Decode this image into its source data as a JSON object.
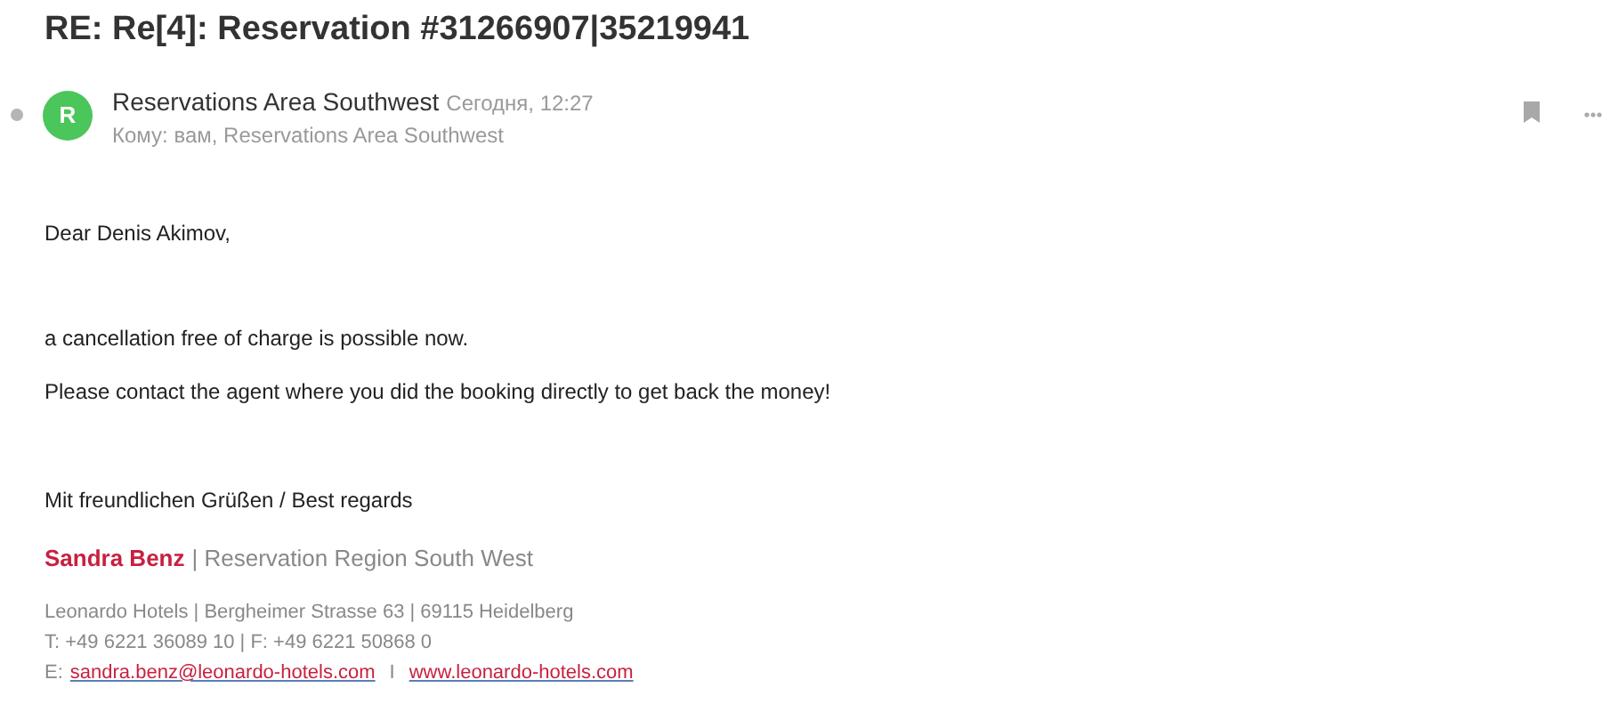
{
  "subject": "RE: Re[4]: Reservation #31266907|35219941",
  "sender": {
    "avatar_letter": "R",
    "name": "Reservations Area Southwest",
    "date": "Сегодня, 12:27",
    "to": "Кому: вам, Reservations Area Southwest"
  },
  "body": {
    "greeting": "Dear Denis Akimov,",
    "paragraphs": [
      "a cancellation free of charge is possible now.",
      "Please contact the agent where you did the booking directly to get back the money!"
    ],
    "closing": "Mit freundlichen Grüßen / Best regards"
  },
  "signature": {
    "name": "Sandra Benz",
    "role": "| Reservation Region South West",
    "address": "Leonardo Hotels | Bergheimer Strasse 63 | 69115 Heidelberg",
    "phone": "T: +49 6221 36089 10 | F: +49 6221 50868 0",
    "email_label": "E:",
    "email": "sandra.benz@leonardo-hotels.com",
    "separator": "I",
    "website": "www.leonardo-hotels.com"
  }
}
